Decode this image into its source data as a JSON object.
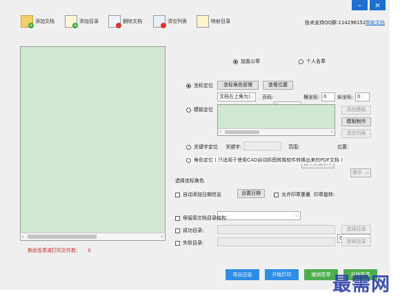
{
  "window": {
    "minimize_label": "–",
    "close_label": "×"
  },
  "toolbar": {
    "items": [
      {
        "label": "添加文档",
        "icon": "add-folder-icon"
      },
      {
        "label": "添加目录",
        "icon": "add-directory-icon"
      },
      {
        "label": "删除文档",
        "icon": "delete-document-icon"
      },
      {
        "label": "清空列表",
        "icon": "clear-list-icon"
      },
      {
        "label": "映射目录",
        "icon": "map-directory-icon"
      }
    ],
    "support_text": "技术支持QQ群:114296152",
    "help_link": "帮助文档"
  },
  "left": {
    "remaining_label": "剩余签章或打印文件数：",
    "remaining_value": "0"
  },
  "stamp_type": {
    "company": "加盖公章",
    "personal": "个人名章",
    "selected": "company"
  },
  "coord": {
    "label": "坐标定位",
    "role_mgmt_button": "坐标角色管理",
    "view_pos_button": "查看位置",
    "position_select": "文档左上角为|",
    "page_label": "页码:",
    "page_value": "1",
    "x_label": "横坐标:",
    "x_value": "0",
    "y_label": "纵坐标:",
    "y_value": "0"
  },
  "template": {
    "label": "模板定位",
    "add_button": "添加模板",
    "make_button": "模板制作",
    "clear_button": "清空列表"
  },
  "keyword": {
    "label": "关键字定位",
    "field_label": "关键字:",
    "range_label": "范围:",
    "range_value": "首个关键字",
    "position_label": "位置:",
    "position_value": "居中"
  },
  "angle": {
    "label": "角色定位 ( 只适用于使用CAD自动拆图转换软件转换出来的PDF文档 )"
  },
  "role_select": {
    "label": "选择坐标角色",
    "value": ""
  },
  "date": {
    "label": "自动添加日期信息",
    "button": "设置日期",
    "overlap_label": "允许印章重叠",
    "rotate_label": "印章旋转:",
    "rotate_value": "0"
  },
  "keep_structure": {
    "label": "保留原文档目录结构"
  },
  "success_dir": {
    "label": "成功目录:",
    "button": "选择目录"
  },
  "fail_dir": {
    "label": "失败目录:",
    "button": "选择目录"
  },
  "bottom": {
    "export_log": "导出日志",
    "start_print": "开始打印",
    "cancel_stamp": "撤销签章",
    "start_stamp": "开始签章"
  },
  "watermark": "最需网",
  "colors": {
    "accent": "#1f6fd1",
    "blue_button": "#2f8de4",
    "green_button": "#4cae4c",
    "preview_bg": "#cfe8cf",
    "watermark": "#2a3ea8"
  }
}
